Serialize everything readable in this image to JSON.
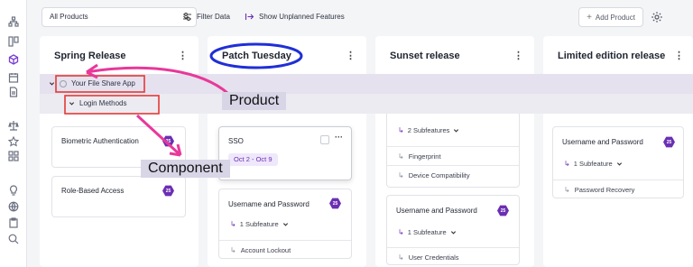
{
  "toolbar": {
    "product_select": "All Products",
    "filter_label": "Filter Data",
    "unplanned_label": "Show Unplanned Features",
    "add_label": "Add Product"
  },
  "columns": [
    {
      "title": "Spring Release"
    },
    {
      "title": "Patch Tuesday"
    },
    {
      "title": "Sunset release"
    },
    {
      "title": "Limited edition release"
    }
  ],
  "bands": {
    "product": "Your File Share App",
    "component": "Login Methods"
  },
  "cards": {
    "biometric": {
      "name": "Biometric Authentication",
      "badge": "25"
    },
    "role_based": {
      "name": "Role-Based Access",
      "badge": "25"
    },
    "sso": {
      "name": "SSO",
      "date": "Oct 2 - Oct 9"
    },
    "up_patch": {
      "name": "Username and Password",
      "badge": "25",
      "sub": "1 Subfeature",
      "child": "Account Lockout"
    },
    "sunset_top": {
      "sub": "2 Subfeatures",
      "child1": "Fingerprint",
      "child2": "Device Compatibility"
    },
    "up_sunset": {
      "name": "Username and Password",
      "badge": "25",
      "sub": "1 Subfeature",
      "child": "User Credentials"
    },
    "up_limited": {
      "name": "Username and Password",
      "badge": "25",
      "sub": "1 Subfeature",
      "child": "Password Recovery"
    }
  },
  "annotations": {
    "product_label": "Product",
    "component_label": "Component"
  },
  "colors": {
    "accent": "#6b2fb3",
    "highlight_pink": "#e8389a",
    "annotation_red": "#e53935",
    "circle_blue": "#1f2fd6"
  }
}
